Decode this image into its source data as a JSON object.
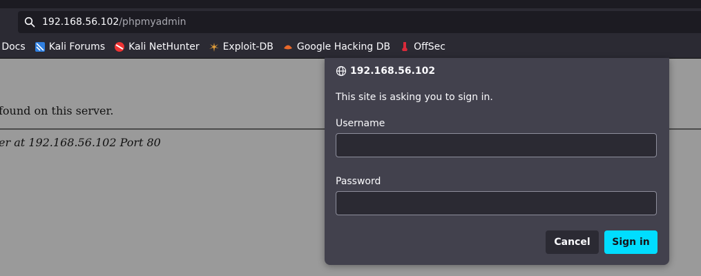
{
  "browser": {
    "url_host": "192.168.56.102",
    "url_path": "/phpmyadmin",
    "bookmarks": [
      {
        "label": "i Docs",
        "icon": "kali-docs-icon"
      },
      {
        "label": "Kali Forums",
        "icon": "kali-forums-icon"
      },
      {
        "label": "Kali NetHunter",
        "icon": "kali-nethunter-icon"
      },
      {
        "label": "Exploit-DB",
        "icon": "exploit-db-icon"
      },
      {
        "label": "Google Hacking DB",
        "icon": "ghdb-icon"
      },
      {
        "label": "OffSec",
        "icon": "offsec-icon"
      }
    ]
  },
  "page": {
    "not_found_text": "found on this server.",
    "address_text": "er at 192.168.56.102 Port 80"
  },
  "dialog": {
    "host": "192.168.56.102",
    "message": "This site is asking you to sign in.",
    "username_label": "Username",
    "password_label": "Password",
    "username_value": "",
    "password_value": "",
    "cancel_label": "Cancel",
    "signin_label": "Sign in"
  },
  "colors": {
    "accent": "#00ddff",
    "dialog_bg": "#42414d",
    "toolbar_bg": "#2b2a33",
    "page_dim": "#9a9a9a"
  }
}
